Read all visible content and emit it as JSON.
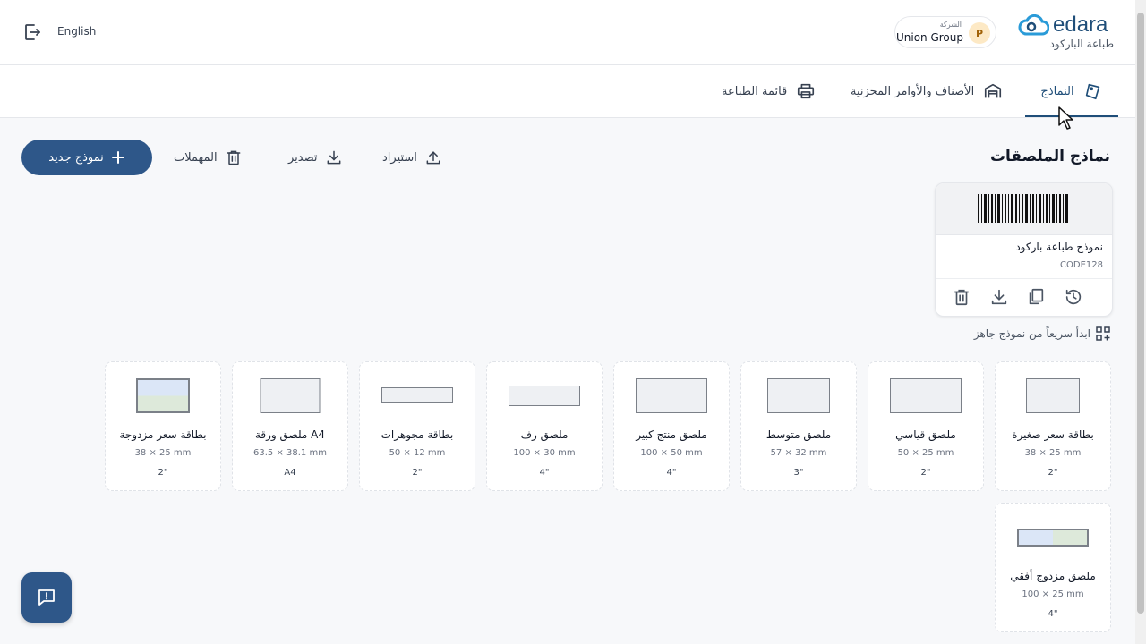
{
  "header": {
    "language": "English",
    "company_label": "الشركة",
    "company_name": "Union Group",
    "company_initial": "P",
    "brand": "edara",
    "brand_subtitle": "طباعة الباركود"
  },
  "tabs": [
    {
      "label": "النماذج",
      "active": true
    },
    {
      "label": "الأصناف والأوامر المخزنية",
      "active": false
    },
    {
      "label": "قائمة الطباعة",
      "active": false
    }
  ],
  "page": {
    "title": "نماذج الملصقات",
    "new_button": "نموذج جديد",
    "trash": "المهملات",
    "export": "تصدير",
    "import": "استيراد"
  },
  "template": {
    "name": "نموذج طباعة باركود",
    "code": "CODE128"
  },
  "quick_start": "ابدأ سريعاً من نموذج جاهز",
  "labels": [
    {
      "name": "بطاقة سعر صغيرة",
      "size": "38 × 25 mm",
      "unit": "2\""
    },
    {
      "name": "ملصق قياسي",
      "size": "50 × 25 mm",
      "unit": "2\""
    },
    {
      "name": "ملصق متوسط",
      "size": "57 × 32 mm",
      "unit": "3\""
    },
    {
      "name": "ملصق منتج كبير",
      "size": "100 × 50 mm",
      "unit": "4\""
    },
    {
      "name": "ملصق رف",
      "size": "100 × 30 mm",
      "unit": "4\""
    },
    {
      "name": "بطاقة مجوهرات",
      "size": "50 × 12 mm",
      "unit": "2\""
    },
    {
      "name": "ملصق ورقة A4",
      "size": "63.5 × 38.1 mm",
      "unit": "A4"
    },
    {
      "name": "بطاقة سعر مزدوجة",
      "size": "38 × 25 mm",
      "unit": "2\""
    },
    {
      "name": "ملصق مزدوج أفقي",
      "size": "100 × 25 mm",
      "unit": "4\""
    }
  ],
  "colors": {
    "primary": "#2e5789",
    "brand": "#1f4e79"
  }
}
